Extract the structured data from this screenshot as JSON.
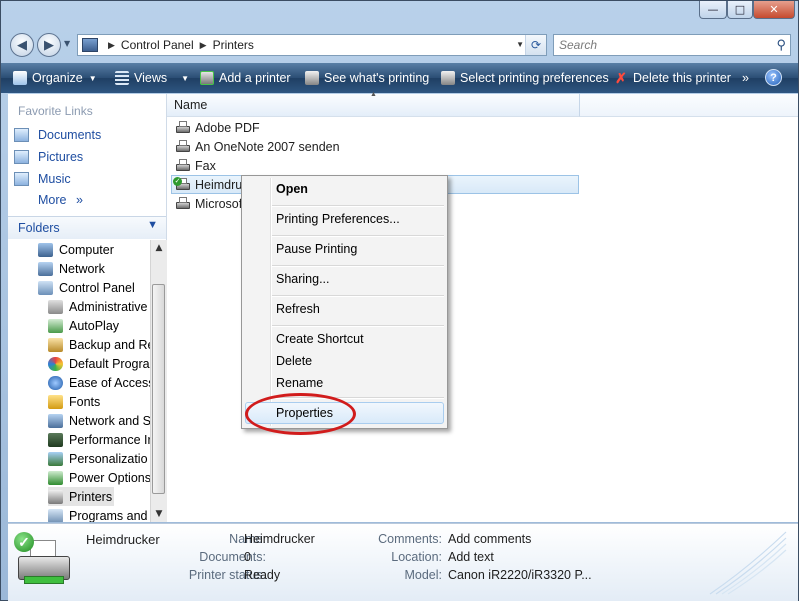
{
  "window": {
    "minimize_glyph": "—",
    "maximize_glyph": "□",
    "close_glyph": "✕"
  },
  "address": {
    "segments": [
      "Control Panel",
      "Printers"
    ],
    "search_placeholder": "Search"
  },
  "toolbar": {
    "items": [
      {
        "label": "Organize",
        "icon": "organize-icon",
        "dropdown": true
      },
      {
        "label": "Views",
        "icon": "views-icon",
        "dropdown": true
      },
      {
        "label": "Add a printer",
        "icon": "add-printer-icon"
      },
      {
        "label": "See what's printing",
        "icon": "printer-queue-icon"
      },
      {
        "label": "Select printing preferences",
        "icon": "printing-preferences-icon"
      },
      {
        "label": "Delete this printer",
        "icon": "delete-icon"
      }
    ],
    "overflow": "»",
    "help": "?"
  },
  "sidebar": {
    "favorites_title": "Favorite Links",
    "favorites": [
      "Documents",
      "Pictures",
      "Music"
    ],
    "more_label": "More",
    "more_glyph": "»",
    "folders_title": "Folders",
    "tree": [
      {
        "label": "Computer",
        "level": 1
      },
      {
        "label": "Network",
        "level": 1
      },
      {
        "label": "Control Panel",
        "level": 1
      },
      {
        "label": "Administrative",
        "level": 2
      },
      {
        "label": "AutoPlay",
        "level": 2
      },
      {
        "label": "Backup and Re",
        "level": 2
      },
      {
        "label": "Default Progra",
        "level": 2
      },
      {
        "label": "Ease of Access",
        "level": 2
      },
      {
        "label": "Fonts",
        "level": 2
      },
      {
        "label": "Network and S",
        "level": 2
      },
      {
        "label": "Performance Ir",
        "level": 2
      },
      {
        "label": "Personalizatio",
        "level": 2
      },
      {
        "label": "Power Options",
        "level": 2
      },
      {
        "label": "Printers",
        "level": 2,
        "selected": true
      },
      {
        "label": "Programs and",
        "level": 2
      }
    ]
  },
  "list": {
    "column_name": "Name",
    "items": [
      {
        "label": "Adobe PDF"
      },
      {
        "label": "An OneNote 2007 senden"
      },
      {
        "label": "Fax"
      },
      {
        "label": "Heimdru",
        "selected": true,
        "default": true
      },
      {
        "label": "Microsof"
      }
    ]
  },
  "context_menu": {
    "items": [
      {
        "label": "Open",
        "bold": true
      },
      {
        "label": "Printing Preferences..."
      },
      {
        "label": "Pause Printing"
      },
      {
        "label": "Sharing..."
      },
      {
        "label": "Refresh"
      },
      {
        "label": "Create Shortcut"
      },
      {
        "label": "Delete"
      },
      {
        "label": "Rename"
      },
      {
        "label": "Properties",
        "highlighted": true
      }
    ]
  },
  "details": {
    "title": "Heimdrucker",
    "fields_left": [
      {
        "label": "Name:",
        "value": "Heimdrucker"
      },
      {
        "label": "Documents:",
        "value": "0"
      },
      {
        "label": "Printer status:",
        "value": "Ready"
      }
    ],
    "fields_right": [
      {
        "label": "Comments:",
        "value": "Add comments"
      },
      {
        "label": "Location:",
        "value": "Add text"
      },
      {
        "label": "Model:",
        "value": "Canon iR2220/iR3320 P..."
      }
    ]
  },
  "colors": {
    "annotation": "#d11c1c",
    "link": "#1f4ea1",
    "toolbar": "#2a4d74"
  }
}
